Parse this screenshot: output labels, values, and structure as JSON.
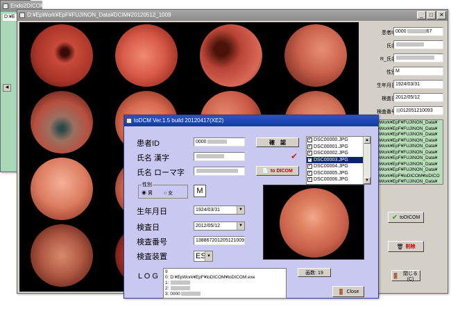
{
  "win_back": {
    "title": "Endo2DICOM",
    "path_text": "D:¥E"
  },
  "win_viewer": {
    "title": "D:¥EpWork¥EpF¥FUJINON_Data¥DCIM¥20120512_1009",
    "patient_fields": [
      {
        "label": "患者ID",
        "value": "0000",
        "suffix": "67"
      },
      {
        "label": "氏名",
        "value": ""
      },
      {
        "label": "R_氏名",
        "value": ""
      },
      {
        "label": "性別",
        "value": "M"
      },
      {
        "label": "生年月日",
        "value": "1924/03/31"
      },
      {
        "label": "検査日",
        "value": "2012/05/12"
      },
      {
        "label": "検査番号",
        "value": "",
        "suffix": "012051210093"
      }
    ],
    "path_list": [
      "D:¥EpWork¥EpF¥FUJINON_Data¥",
      "D:¥EpWork¥EpF¥FUJINON_Data¥",
      "D:¥EpWork¥EpF¥FUJINON_Data¥",
      "D:¥EpWork¥EpF¥FUJINON_Data¥",
      "D:¥EpWork¥EpF¥FUJINON_Data¥",
      "D:¥EpWork¥EpF¥FUJINON_Data¥",
      "D:¥EpWork¥EpF¥FUJINON_Data¥",
      "D:¥EpWork¥EpF¥FUJINON_Data¥",
      "D:¥EpWork¥EpF¥FUJINON_Data¥",
      "D:¥EpWork¥EpF¥toDICOM¥toDICO",
      "D:¥EpWork¥EpF¥FUJINON_Data¥"
    ],
    "todicom_button": "toDICOM",
    "delete_button": "削除",
    "close_button": "閉じる(C)"
  },
  "dialog": {
    "title": "toDCM Ver.1.5 build 20120417(XE2)",
    "labels": {
      "patient_id": "患者ID",
      "name_kanji": "氏名 漢字",
      "name_roman": "氏名 ローマ字",
      "sex_group": "性別",
      "sex_male": "男",
      "sex_female": "女",
      "dob": "生年月日",
      "exam_date": "検査日",
      "exam_no": "検査番号",
      "modality": "検査装置",
      "log": "L O G"
    },
    "values": {
      "patient_id": "0000",
      "name_kanji": "",
      "name_roman": "",
      "sex_display": "M",
      "dob": "1924/03/31",
      "exam_date": "2012/05/12",
      "exam_no": "138867201205121009",
      "modality": "ES"
    },
    "confirm_button": "確　認",
    "todicom_button": "to DICOM",
    "files": [
      "DSC00000.JPG",
      "DSC00001.JPG",
      "DSC00002.JPG",
      "DSC00003.JPG",
      "DSC00004.JPG",
      "DSC00005.JPG",
      "DSC00006.JPG"
    ],
    "selected_file_index": 3,
    "image_count": "画数: 19",
    "log_lines": [
      "9",
      "0: D:¥EpWork¥EpF¥toDICOM¥toDICOM.exe",
      "1: ",
      "2: ",
      "3: 0000"
    ],
    "close_button": "Close"
  },
  "colors": {
    "dialog_bg": "#c8c8f0",
    "list_bg": "#b8ddb8",
    "title_active": "#1e46b4",
    "title_inactive": "#9a9a9a"
  }
}
